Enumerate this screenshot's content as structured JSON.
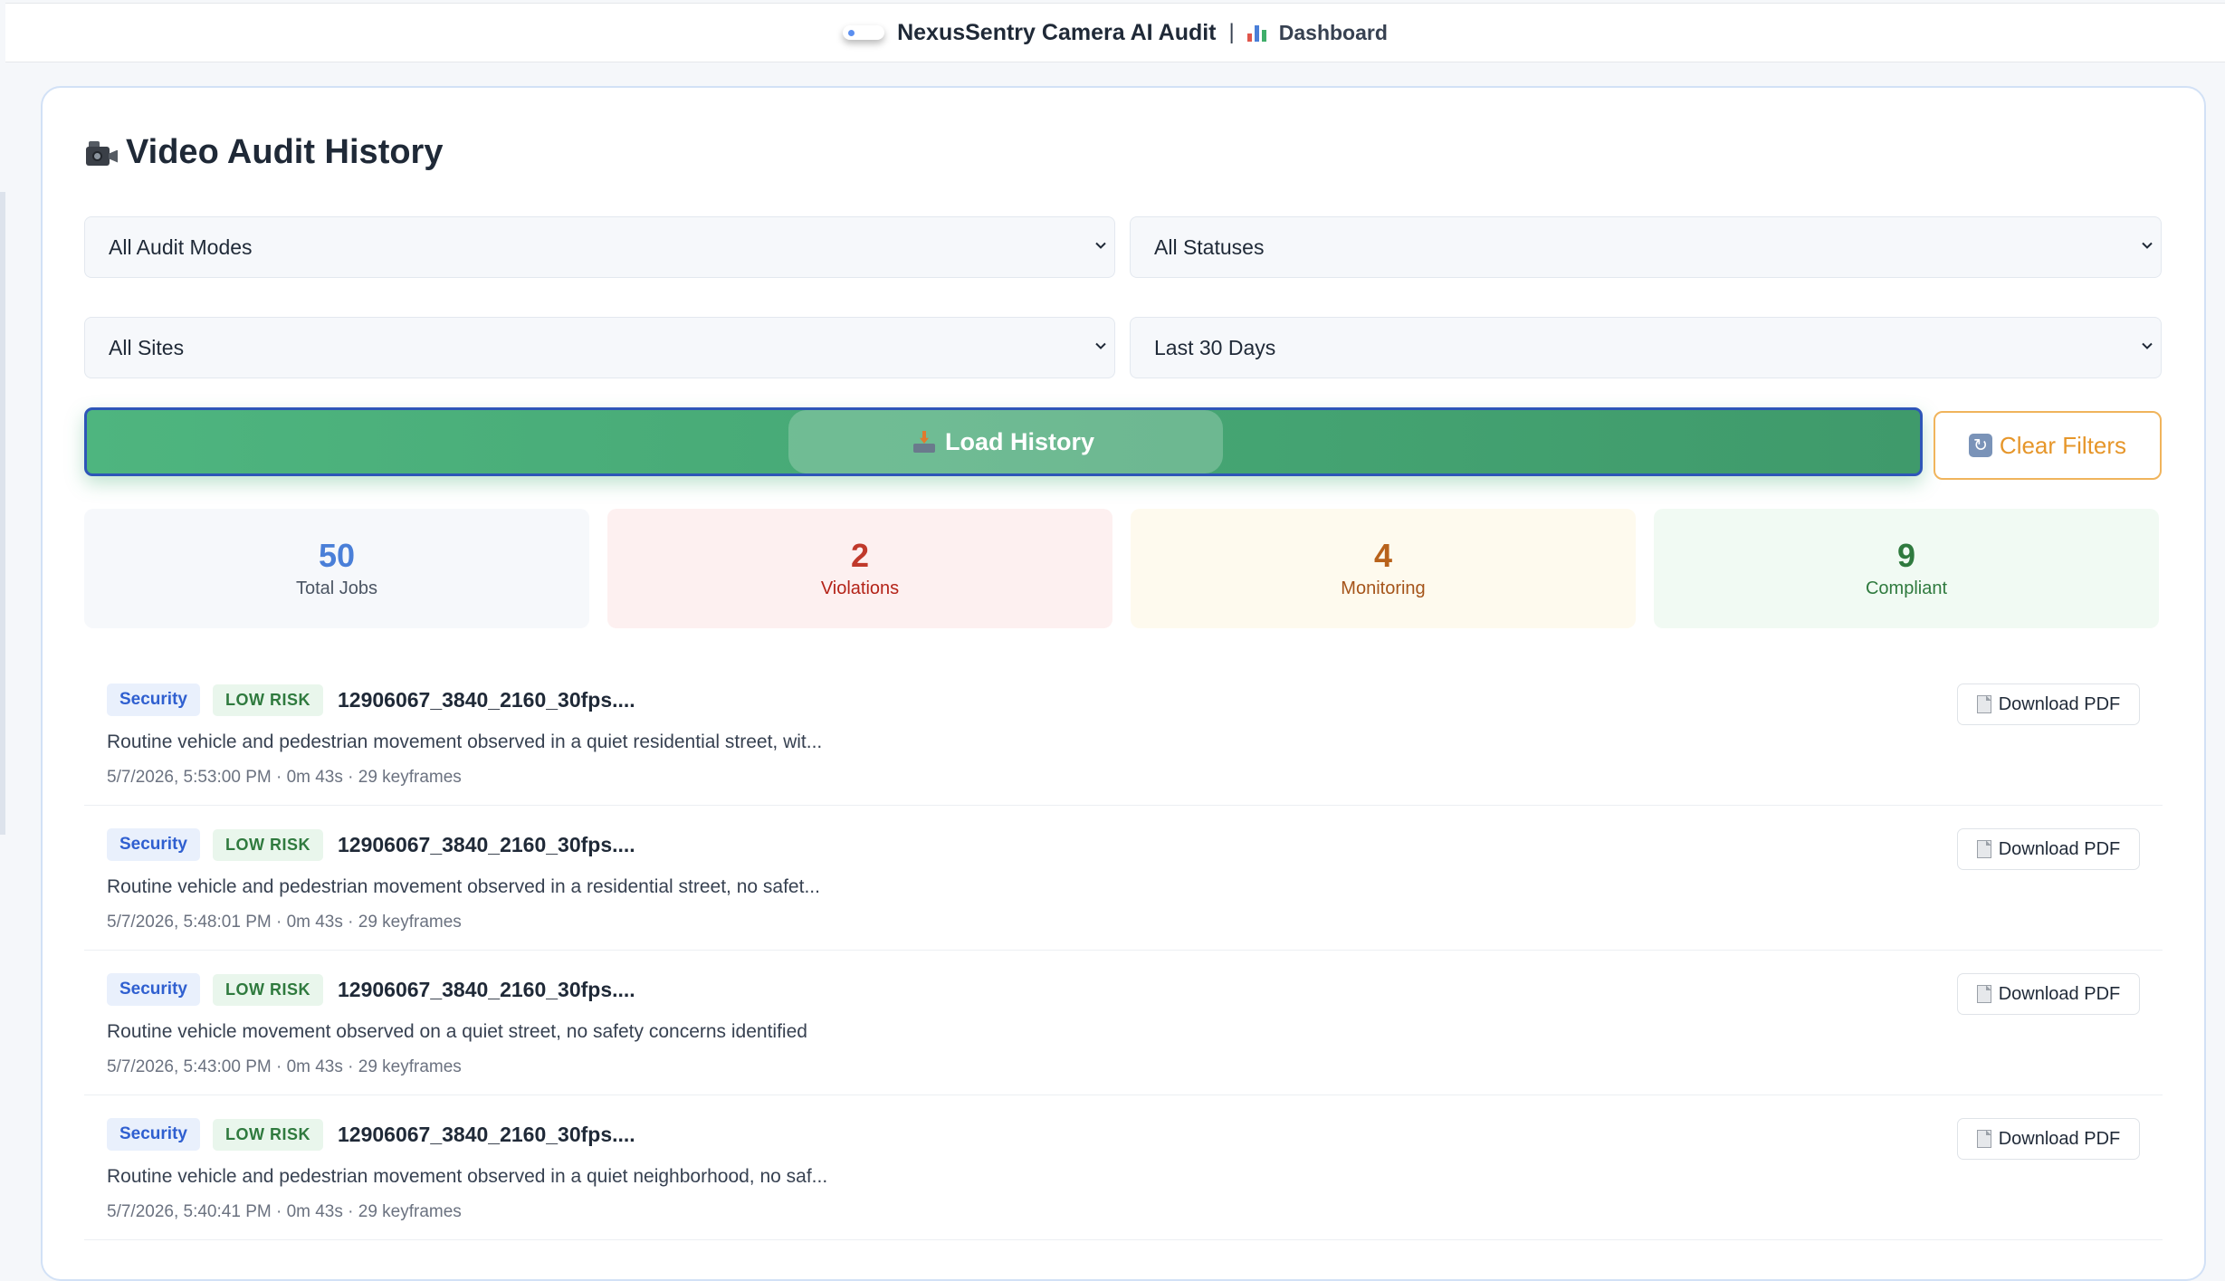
{
  "topbar": {
    "app_title": "NexusSentry Camera AI Audit",
    "separator": "|",
    "dashboard_label": "Dashboard"
  },
  "page": {
    "heading": "Video Audit History"
  },
  "filters": {
    "audit_mode": "All Audit Modes",
    "status": "All Statuses",
    "site": "All Sites",
    "date_range": "Last 30 Days"
  },
  "actions": {
    "load_history": "Load History",
    "clear_filters": "Clear Filters"
  },
  "stats": [
    {
      "value": "50",
      "label": "Total Jobs",
      "color": "#4a7fd8",
      "bg": "#f6f8fb",
      "label_color": "#4b5563"
    },
    {
      "value": "2",
      "label": "Violations",
      "color": "#c0392b",
      "bg": "#fdf0f0",
      "label_color": "#b42318"
    },
    {
      "value": "4",
      "label": "Monitoring",
      "color": "#b8621b",
      "bg": "#fefaee",
      "label_color": "#a5541a"
    },
    {
      "value": "9",
      "label": "Compliant",
      "color": "#2f7a3e",
      "bg": "#f1faf3",
      "label_color": "#2f7a3e"
    }
  ],
  "jobs": [
    {
      "mode": "Security",
      "risk": "LOW RISK",
      "name": "12906067_3840_2160_30fps....",
      "description": "Routine vehicle and pedestrian movement observed in a quiet residential street, wit...",
      "meta": "5/7/2026, 5:53:00 PM · 0m 43s · 29 keyframes",
      "download_label": "Download PDF"
    },
    {
      "mode": "Security",
      "risk": "LOW RISK",
      "name": "12906067_3840_2160_30fps....",
      "description": "Routine vehicle and pedestrian movement observed in a residential street, no safet...",
      "meta": "5/7/2026, 5:48:01 PM · 0m 43s · 29 keyframes",
      "download_label": "Download PDF"
    },
    {
      "mode": "Security",
      "risk": "LOW RISK",
      "name": "12906067_3840_2160_30fps....",
      "description": "Routine vehicle movement observed on a quiet street, no safety concerns identified",
      "meta": "5/7/2026, 5:43:00 PM · 0m 43s · 29 keyframes",
      "download_label": "Download PDF"
    },
    {
      "mode": "Security",
      "risk": "LOW RISK",
      "name": "12906067_3840_2160_30fps....",
      "description": "Routine vehicle and pedestrian movement observed in a quiet neighborhood, no saf...",
      "meta": "5/7/2026, 5:40:41 PM · 0m 43s · 29 keyframes",
      "download_label": "Download PDF"
    }
  ],
  "icons": {
    "logo": "logo-icon",
    "dashboard": "bar-chart-icon",
    "heading": "video-camera-icon",
    "load": "inbox-tray-icon",
    "clear": "refresh-icon",
    "download": "document-icon"
  }
}
